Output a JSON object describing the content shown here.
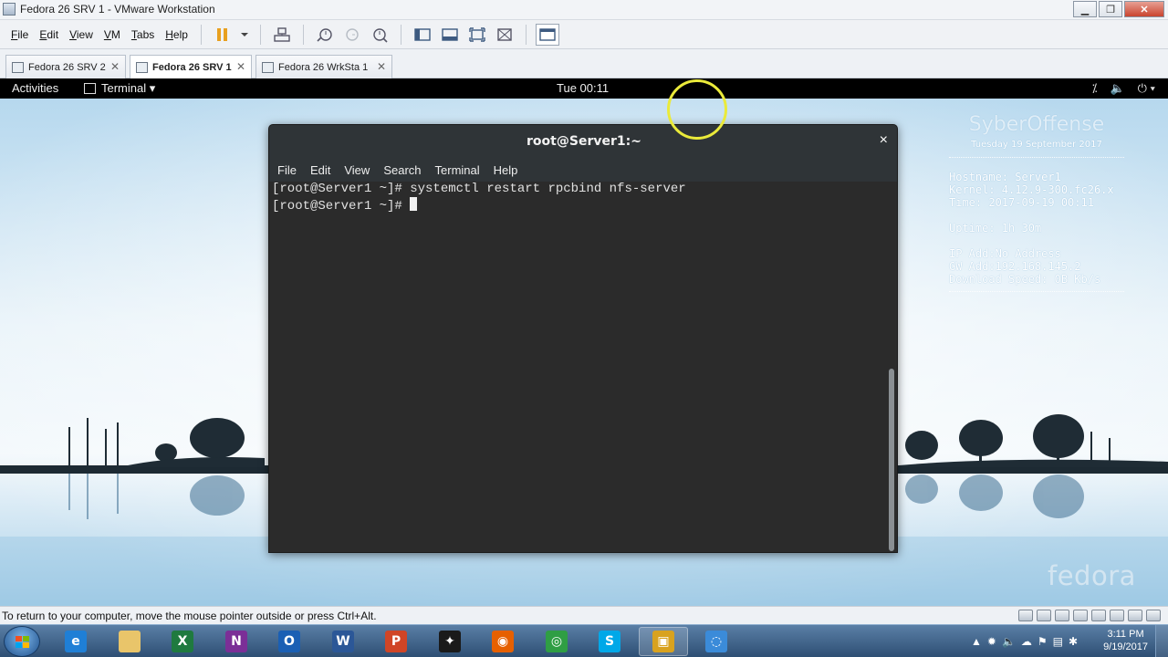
{
  "vm": {
    "window_title": "Fedora 26 SRV 1 - VMware Workstation",
    "menu": [
      "File",
      "Edit",
      "View",
      "VM",
      "Tabs",
      "Help"
    ],
    "menu_underline": [
      "F",
      "E",
      "V",
      "V",
      "T",
      "H"
    ],
    "tabs": [
      {
        "label": "Fedora 26 SRV 2"
      },
      {
        "label": "Fedora 26 SRV 1"
      },
      {
        "label": "Fedora 26 WrkSta 1"
      }
    ],
    "status_message": "To return to your computer, move the mouse pointer outside or press Ctrl+Alt."
  },
  "gnome": {
    "activities": "Activities",
    "app_menu": "Terminal ▾",
    "clock": "Tue 00:11"
  },
  "terminal": {
    "title": "root@Server1:~",
    "close": "×",
    "menu": [
      "File",
      "Edit",
      "View",
      "Search",
      "Terminal",
      "Help"
    ],
    "lines": [
      "[root@Server1 ~]# systemctl restart rpcbind nfs-server",
      "[root@Server1 ~]# "
    ]
  },
  "conky": {
    "brand": "SyberOffense",
    "date": "Tuesday 19 September 2017",
    "hostname": "Hostname: Server1",
    "kernel": "Kernel: 4.12.9-300.fc26.x",
    "time": "Time: 2017-09-19 00:11",
    "uptime": "Uptime: 1h 30m",
    "ip": "IP Add:No Address",
    "gw": "GW Add:192.168.145.2",
    "speed": "Download Speed: 0B Kb/s"
  },
  "wallpaper_logo": "fedora",
  "taskbar": {
    "apps": [
      {
        "name": "internet-explorer",
        "glyph": "e",
        "color": "#1f7fd6"
      },
      {
        "name": "file-explorer",
        "glyph": "",
        "color": "#e9c56a"
      },
      {
        "name": "excel",
        "glyph": "X",
        "color": "#1f7a3f"
      },
      {
        "name": "onenote",
        "glyph": "N",
        "color": "#7b2f97"
      },
      {
        "name": "outlook",
        "glyph": "O",
        "color": "#1a5fb4"
      },
      {
        "name": "word",
        "glyph": "W",
        "color": "#2b5797"
      },
      {
        "name": "powerpoint",
        "glyph": "P",
        "color": "#d04526"
      },
      {
        "name": "red-app",
        "glyph": "✦",
        "color": "#1a1a1a"
      },
      {
        "name": "firefox",
        "glyph": "◉",
        "color": "#e66000"
      },
      {
        "name": "chrome",
        "glyph": "◎",
        "color": "#2f9e44"
      },
      {
        "name": "skype",
        "glyph": "S",
        "color": "#00a8e8"
      },
      {
        "name": "vmware",
        "glyph": "▣",
        "color": "#d8a21f"
      },
      {
        "name": "media-app",
        "glyph": "◌",
        "color": "#3b8bd9"
      }
    ],
    "time": "3:11 PM",
    "date": "9/19/2017"
  }
}
